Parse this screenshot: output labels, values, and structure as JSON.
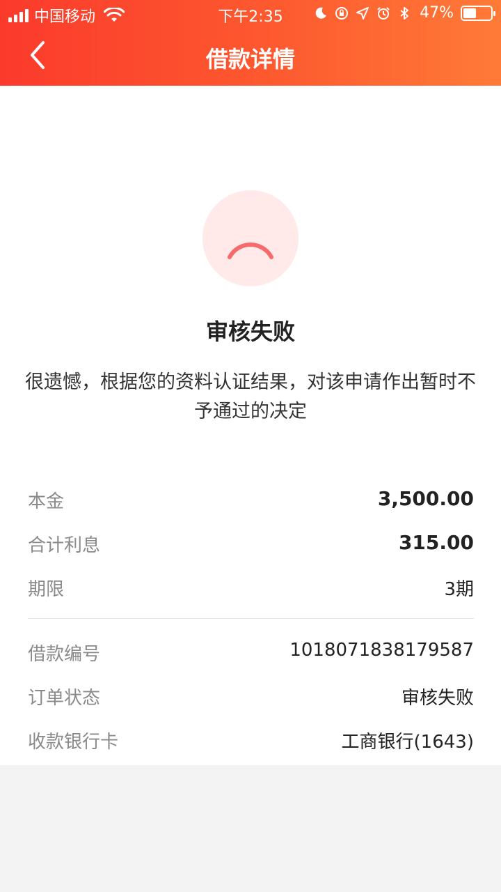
{
  "status_bar": {
    "carrier": "中国移动",
    "time": "下午2:35",
    "battery_percent": "47%",
    "battery_level": 0.47,
    "icons": [
      "signal-icon",
      "wifi-icon",
      "moon-icon",
      "rotation-lock-icon",
      "location-icon",
      "alarm-icon",
      "bluetooth-icon",
      "battery-icon"
    ]
  },
  "navbar": {
    "title": "借款详情",
    "back_icon": "chevron-left-icon"
  },
  "result": {
    "icon": "sad-face-icon",
    "title": "审核失败",
    "description": "很遗憾，根据您的资料认证结果，对该申请作出暂时不予通过的决定"
  },
  "details": {
    "loan": [
      {
        "label": "本金",
        "value": "3,500.00"
      },
      {
        "label": "合计利息",
        "value": "315.00"
      },
      {
        "label": "期限",
        "value": "3期"
      }
    ],
    "order": [
      {
        "label": "借款编号",
        "value": "1018071838179587"
      },
      {
        "label": "订单状态",
        "value": "审核失败"
      },
      {
        "label": "收款银行卡",
        "value": "工商银行(1643)"
      }
    ]
  },
  "colors": {
    "header_start": "#fb3a2c",
    "header_end": "#ff7a37",
    "fail_circle_bg": "#ffe9e9",
    "fail_arc": "#f76a6a",
    "label_gray": "#8a8a8a"
  }
}
